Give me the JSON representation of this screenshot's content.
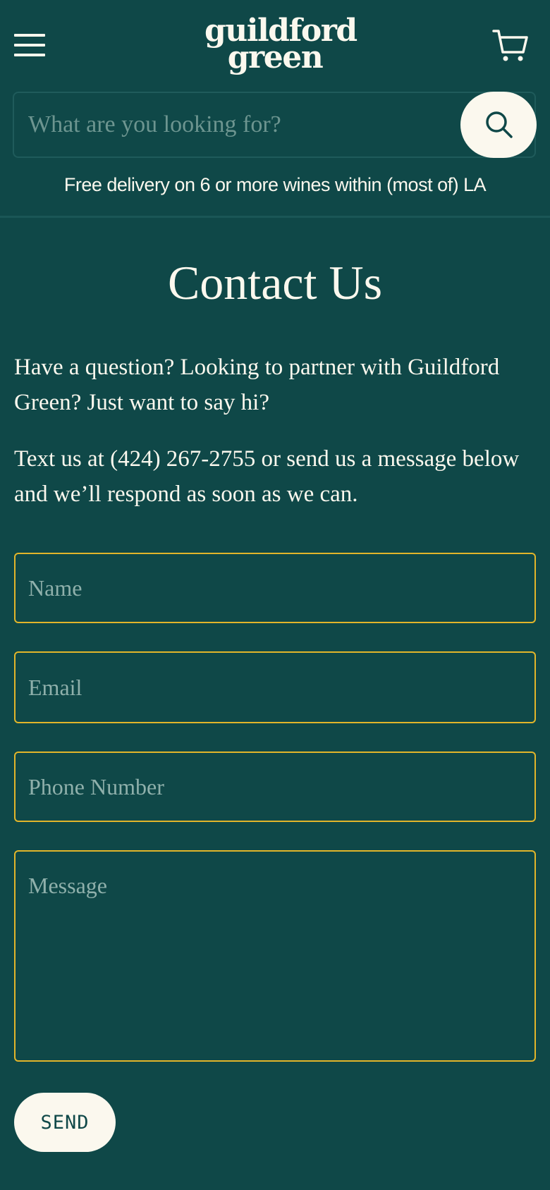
{
  "header": {
    "logo_line1": "guildford",
    "logo_line2": "green",
    "menu_icon": "hamburger-menu-icon",
    "cart_icon": "shopping-cart-icon"
  },
  "search": {
    "placeholder": "What are you looking for?",
    "icon": "search-icon"
  },
  "promo": {
    "text": "Free delivery on 6 or more wines within (most of) LA"
  },
  "contact": {
    "title": "Contact Us",
    "intro_1": "Have a question? Looking to partner with Guildford Green? Just want to say hi?",
    "intro_2": "Text us at (424) 267-2755 or send us a message below and we’ll respond as soon as we can."
  },
  "form": {
    "name_placeholder": "Name",
    "email_placeholder": "Email",
    "phone_placeholder": "Phone Number",
    "message_placeholder": "Message",
    "send_label": "SEND"
  },
  "colors": {
    "background": "#0f4848",
    "cream": "#fbf8ee",
    "field_border": "#e2b52a",
    "placeholder": "#8fb0ab"
  }
}
